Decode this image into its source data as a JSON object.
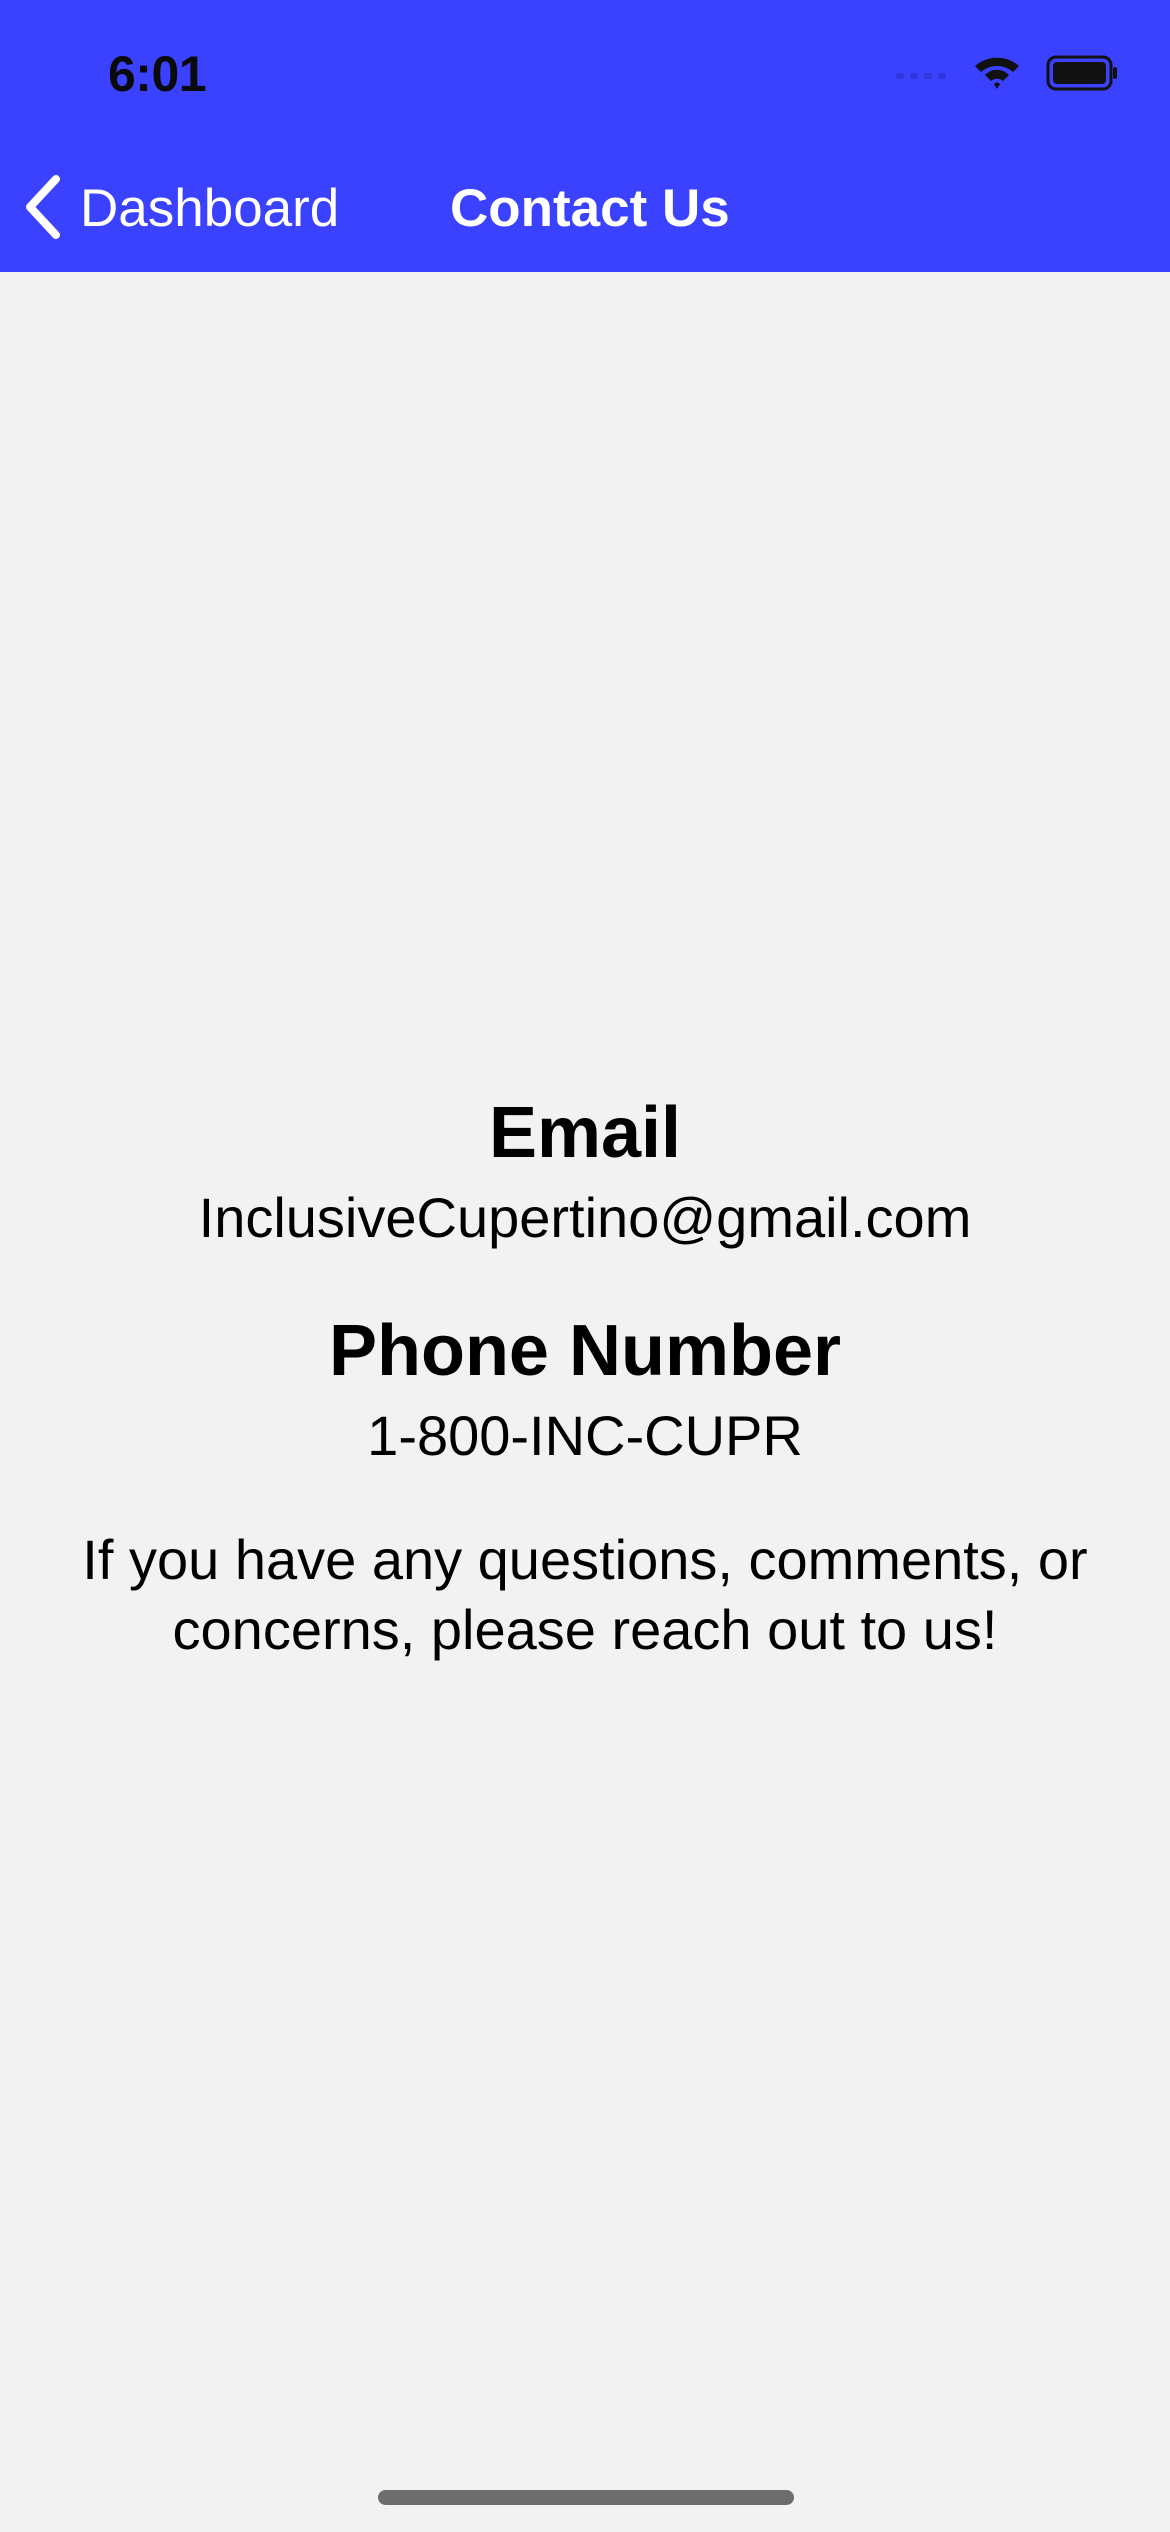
{
  "status_bar": {
    "time": "6:01",
    "icons": [
      "signal-icon",
      "wifi-icon",
      "battery-icon"
    ]
  },
  "nav": {
    "back_label": "Dashboard",
    "title": "Contact Us",
    "back_icon": "chevron-left-icon"
  },
  "contact": {
    "email_heading": "Email",
    "email_value": "InclusiveCupertino@gmail.com",
    "phone_heading": "Phone Number",
    "phone_value": "1-800-INC-CUPR",
    "message": "If you have any questions, comments, or concerns, please reach out to us!"
  },
  "colors": {
    "nav_background": "#3a41ff",
    "page_background": "#f2f2f2",
    "nav_text": "#ffffff",
    "body_text": "#000000"
  }
}
